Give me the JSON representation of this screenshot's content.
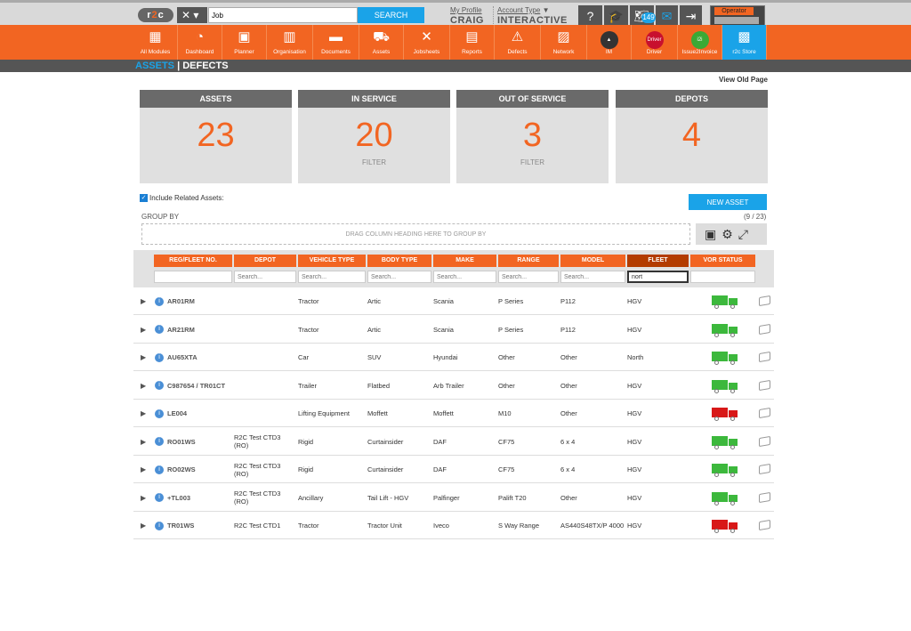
{
  "topbar": {
    "logo": "r2c",
    "job_value": "Job",
    "search_label": "SEARCH",
    "my_profile": "My Profile",
    "username": "CRAIG",
    "account_type_label": "Account Type",
    "account_type": "INTERACTIVE",
    "notification_count": "149",
    "operator_label": "Operator"
  },
  "nav": [
    {
      "label": "All Modules",
      "icon": "grid-icon"
    },
    {
      "label": "Dashboard",
      "icon": "gauge-icon"
    },
    {
      "label": "Planner",
      "icon": "calendar-icon"
    },
    {
      "label": "Organisation",
      "icon": "building-icon"
    },
    {
      "label": "Documents",
      "icon": "folder-icon"
    },
    {
      "label": "Assets",
      "icon": "truck-icon"
    },
    {
      "label": "Jobsheets",
      "icon": "tools-icon"
    },
    {
      "label": "Reports",
      "icon": "clipboard-icon"
    },
    {
      "label": "Defects",
      "icon": "warning-icon"
    },
    {
      "label": "Network",
      "icon": "contact-icon"
    },
    {
      "label": "IM",
      "icon": "im-icon"
    },
    {
      "label": "Driver",
      "icon": "driver-icon",
      "badge": "Driver"
    },
    {
      "label": "Issue2Invoice",
      "icon": "i2i-icon",
      "badge": "i2i"
    },
    {
      "label": "r2c Store",
      "icon": "briefcase-icon"
    }
  ],
  "subnav": {
    "assets": "ASSETS",
    "sep": "|",
    "defects": "DEFECTS"
  },
  "view_old_page": "View Old Page",
  "cards": [
    {
      "title": "ASSETS",
      "value": "23",
      "footer": ""
    },
    {
      "title": "IN SERVICE",
      "value": "20",
      "footer": "FILTER"
    },
    {
      "title": "OUT OF SERVICE",
      "value": "3",
      "footer": "FILTER"
    },
    {
      "title": "DEPOTS",
      "value": "4",
      "footer": ""
    }
  ],
  "include_related": "Include Related Assets:",
  "new_asset": "NEW ASSET",
  "group_by": "GROUP BY",
  "count": "(9 / 23)",
  "drag_hint": "DRAG COLUMN HEADING HERE TO GROUP BY",
  "columns": [
    "REG/FLEET NO.",
    "DEPOT",
    "VEHICLE TYPE",
    "BODY TYPE",
    "MAKE",
    "RANGE",
    "MODEL",
    "FLEET",
    "VOR STATUS"
  ],
  "filter_placeholder": "Search...",
  "fleet_filter_value": "nort",
  "rows": [
    {
      "reg": "AR01RM",
      "depot": "",
      "vehicle_type": "Tractor",
      "body_type": "Artic",
      "make": "Scania",
      "range": "P Series",
      "model": "P112",
      "fleet": "HGV",
      "vor": "green"
    },
    {
      "reg": "AR21RM",
      "depot": "",
      "vehicle_type": "Tractor",
      "body_type": "Artic",
      "make": "Scania",
      "range": "P Series",
      "model": "P112",
      "fleet": "HGV",
      "vor": "green"
    },
    {
      "reg": "AU65XTA",
      "depot": "",
      "vehicle_type": "Car",
      "body_type": "SUV",
      "make": "Hyundai",
      "range": "Other",
      "model": "Other",
      "fleet": "North",
      "vor": "green"
    },
    {
      "reg": "C987654 / TR01CT",
      "depot": "",
      "vehicle_type": "Trailer",
      "body_type": "Flatbed",
      "make": "Arb Trailer",
      "range": "Other",
      "model": "Other",
      "fleet": "HGV",
      "vor": "green"
    },
    {
      "reg": "LE004",
      "depot": "",
      "vehicle_type": "Lifting Equipment",
      "body_type": "Moffett",
      "make": "Moffett",
      "range": "M10",
      "model": "Other",
      "fleet": "HGV",
      "vor": "red"
    },
    {
      "reg": "RO01WS",
      "depot": "R2C Test CTD3 (RO)",
      "vehicle_type": "Rigid",
      "body_type": "Curtainsider",
      "make": "DAF",
      "range": "CF75",
      "model": "6 x 4",
      "fleet": "HGV",
      "vor": "green"
    },
    {
      "reg": "RO02WS",
      "depot": "R2C Test CTD3 (RO)",
      "vehicle_type": "Rigid",
      "body_type": "Curtainsider",
      "make": "DAF",
      "range": "CF75",
      "model": "6 x 4",
      "fleet": "HGV",
      "vor": "green"
    },
    {
      "reg": "+TL003",
      "depot": "R2C Test CTD3 (RO)",
      "vehicle_type": "Ancillary",
      "body_type": "Tail Lift - HGV",
      "make": "Palfinger",
      "range": "Palift T20",
      "model": "Other",
      "fleet": "HGV",
      "vor": "green"
    },
    {
      "reg": "TR01WS",
      "depot": "R2C Test CTD1",
      "vehicle_type": "Tractor",
      "body_type": "Tractor Unit",
      "make": "Iveco",
      "range": "S Way Range",
      "model": "AS440S48TX/P 4000",
      "fleet": "HGV",
      "vor": "red"
    }
  ],
  "colors": {
    "brand_orange": "#f26522",
    "accent_blue": "#1aa3e8",
    "vor_green": "#3cb83c",
    "vor_red": "#d81818"
  }
}
